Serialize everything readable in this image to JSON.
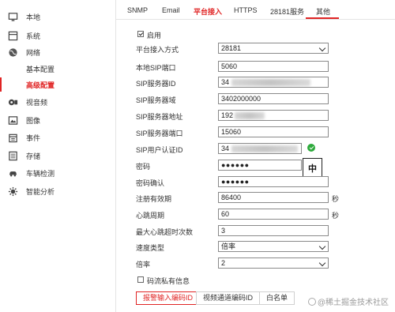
{
  "sidebar": {
    "items": [
      {
        "label": "本地",
        "icon": "monitor-icon"
      },
      {
        "label": "系统",
        "icon": "system-icon"
      },
      {
        "label": "网络",
        "icon": "globe-icon"
      },
      {
        "label": "基本配置",
        "icon": ""
      },
      {
        "label": "高级配置",
        "icon": ""
      },
      {
        "label": "视音频",
        "icon": "video-audio-icon"
      },
      {
        "label": "图像",
        "icon": "image-icon"
      },
      {
        "label": "事件",
        "icon": "calendar-icon"
      },
      {
        "label": "存储",
        "icon": "storage-icon"
      },
      {
        "label": "车辆检测",
        "icon": "car-icon"
      },
      {
        "label": "智能分析",
        "icon": "smart-analysis-icon"
      }
    ]
  },
  "tabs": [
    "SNMP",
    "Email",
    "平台接入",
    "HTTPS",
    "28181服务",
    "其他"
  ],
  "form": {
    "enable_label": "启用",
    "access_mode": {
      "label": "平台接入方式",
      "value": "28181"
    },
    "local_sip_port": {
      "label": "本地SIP端口",
      "value": "5060"
    },
    "sip_server_id": {
      "label": "SIP服务器ID",
      "value": "34"
    },
    "sip_server_domain": {
      "label": "SIP服务器域",
      "value": "3402000000"
    },
    "sip_server_address": {
      "label": "SIP服务器地址",
      "value": "192"
    },
    "sip_server_port": {
      "label": "SIP服务器端口",
      "value": "15060"
    },
    "sip_user_id": {
      "label": "SIP用户认证ID",
      "value": "34"
    },
    "password": {
      "label": "密码",
      "value": "●●●●●●"
    },
    "password_confirm": {
      "label": "密码确认",
      "value": "●●●●●●"
    },
    "register_validity": {
      "label": "注册有效期",
      "value": "86400",
      "unit": "秒"
    },
    "heartbeat_period": {
      "label": "心跳周期",
      "value": "60",
      "unit": "秒"
    },
    "max_heartbeat_timeouts": {
      "label": "最大心跳超时次数",
      "value": "3"
    },
    "speed_type": {
      "label": "速度类型",
      "value": "倍率"
    },
    "rate": {
      "label": "倍率",
      "value": "2"
    },
    "private_stream_label": "码流私有信息"
  },
  "ime_indicator": "中",
  "subtabs": [
    "报警输入编码ID",
    "视频通道编码ID",
    "白名单"
  ],
  "watermark": "@稀土掘金技术社区",
  "colors": {
    "accent": "#e02424",
    "ok": "#2eaa3c"
  }
}
